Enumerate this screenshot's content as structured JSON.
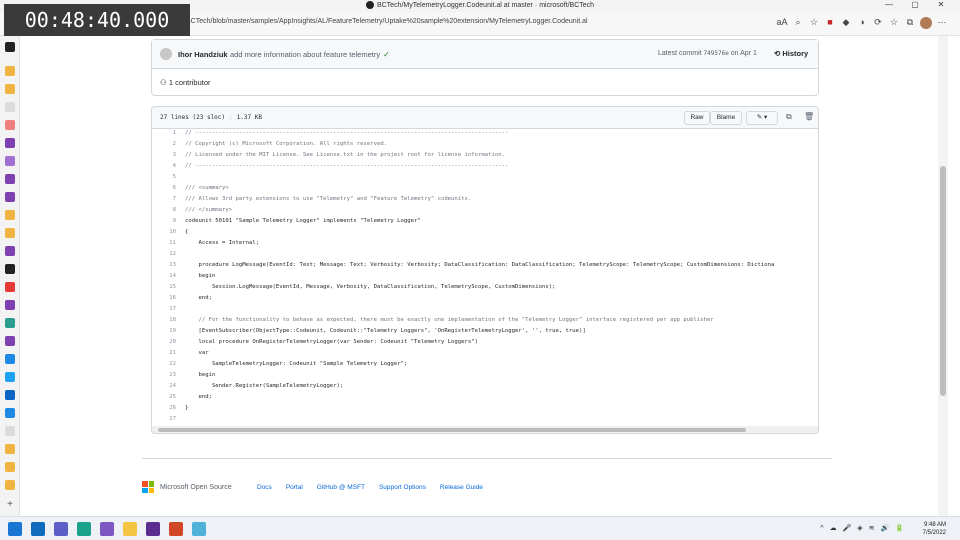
{
  "overlay": {
    "timestamp": "00:48:40.000"
  },
  "browser": {
    "title": "BCTech/MyTelemetryLogger.Codeunit.al at master · microsoft/BCTech",
    "url": "BCTech/blob/master/samples/AppInsights/AL/FeatureTelemetry/Uptake%20sample%20extension/MyTelemetryLogger.Codeunit.al",
    "window_controls": [
      "—",
      "▢",
      "✕"
    ],
    "toolbar_icons": [
      "aA",
      "⌕",
      "☆",
      "■",
      "◆",
      "◑",
      "⟳",
      "☆",
      "⧉",
      "●",
      "⋯"
    ]
  },
  "commit": {
    "author": "Ihor Handziuk",
    "message": "add more information about feature telemetry",
    "check": "✓",
    "latest_label": "Latest commit",
    "sha": "749576e",
    "date": "on Apr 1",
    "history_label": "History",
    "contributors": "1 contributor"
  },
  "file": {
    "lines_info": "27 lines (23 sloc)",
    "size": "1.37 KB",
    "raw_label": "Raw",
    "blame_label": "Blame",
    "code": [
      "// ---------------------------------------------------------------------------------------------",
      "// Copyright (c) Microsoft Corporation. All rights reserved.",
      "// Licensed under the MIT License. See License.txt in the project root for license information.",
      "// ---------------------------------------------------------------------------------------------",
      "",
      "/// <summary>",
      "/// Allows 3rd party extensions to use \"Telemetry\" and \"Feature Telemetry\" codeunits.",
      "/// </summary>",
      "codeunit 50101 \"Sample Telemetry Logger\" implements \"Telemetry Logger\"",
      "{",
      "    Access = Internal;",
      "",
      "    procedure LogMessage(EventId: Text; Message: Text; Verbosity: Verbosity; DataClassification: DataClassification; TelemetryScope: TelemetryScope; CustomDimensions: Dictiona",
      "    begin",
      "        Session.LogMessage(EventId, Message, Verbosity, DataClassification, TelemetryScope, CustomDimensions);",
      "    end;",
      "",
      "    // For the functionality to behave as expected, there must be exactly one implementation of the \"Telemetry Logger\" interface registered per app publisher",
      "    [EventSubscriber(ObjectType::Codeunit, Codeunit::\"Telemetry Loggers\", 'OnRegisterTelemetryLogger', '', true, true)]",
      "    local procedure OnRegisterTelemetryLogger(var Sender: Codeunit \"Telemetry Loggers\")",
      "    var",
      "        SampleTelemetryLogger: Codeunit \"Sample Telemetry Logger\";",
      "    begin",
      "        Sender.Register(SampleTelemetryLogger);",
      "    end;",
      "}",
      ""
    ]
  },
  "footer": {
    "brand": "Microsoft Open Source",
    "links": [
      "Docs",
      "Portal",
      "GitHub @ MSFT",
      "Support Options",
      "Release Guide"
    ]
  },
  "taskbar": {
    "time": "9:48 AM",
    "date": "7/5/2022",
    "tray_icons": [
      "^",
      "☁",
      "🎤",
      "◈",
      "≋",
      "🔊",
      "🔋"
    ]
  },
  "colors": {
    "accent": "#0969da",
    "keyword": "#cf222e",
    "type": "#8250df",
    "string": "#0a3069",
    "comment": "#6e7781"
  }
}
